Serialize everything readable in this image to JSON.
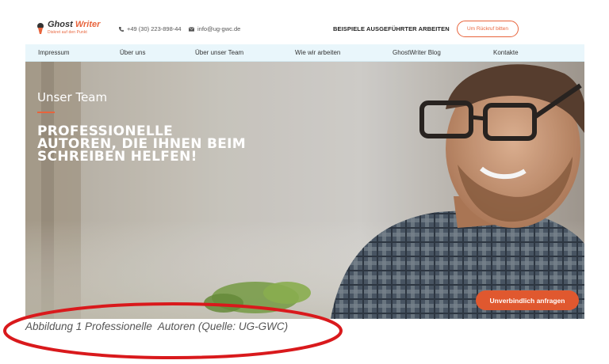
{
  "header": {
    "logo": {
      "title_main": "Ghost ",
      "title_accent": "Writer",
      "tagline": "Diskret auf den Punkt"
    },
    "phone": "+49 (30) 223-898-44",
    "email": "info@ug-gwc.de",
    "examples_link": "BEISPIELE AUSGEFÜHRTER ARBEITEN",
    "callback_button": "Um Rückruf bitten"
  },
  "nav": {
    "items": [
      "Impressum",
      "Über uns",
      "Über unser Team",
      "Wie wir arbeiten",
      "GhostWriter Blog",
      "Kontakte"
    ]
  },
  "hero": {
    "title": "Unser Team",
    "heading_lines": [
      "PROFESSIONELLE",
      "AUTOREN, DIE IHNEN BEIM",
      "SCHREIBEN HELFEN!"
    ],
    "cta_button": "Unverbindlich anfragen"
  },
  "caption": "Abbildung 1 Professionelle  Autoren (Quelle: UG-GWC)",
  "colors": {
    "accent": "#e8643c",
    "nav_bg": "#e9f6fb",
    "annotation": "#d9191c"
  }
}
